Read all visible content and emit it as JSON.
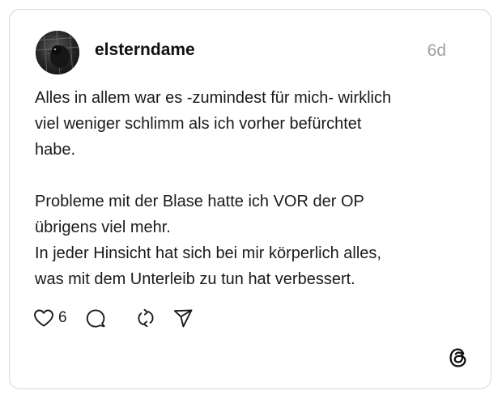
{
  "post": {
    "username": "elsterndame",
    "timestamp": "6d",
    "paragraphs": [
      "Alles in allem war es -zumindest für mich- wirklich\nviel weniger schlimm als ich vorher befürchtet\nhabe.",
      "Probleme mit der Blase hatte ich VOR der OP\nübrigens viel mehr.\nIn jeder Hinsicht hat sich bei mir körperlich alles,\nwas mit dem Unterleib zu tun hat verbessert."
    ]
  },
  "actions": {
    "like_count": "6",
    "icons": [
      "heart-icon",
      "comment-icon",
      "repost-icon",
      "share-icon"
    ]
  },
  "branding": {
    "logo_icon": "threads-logo-icon"
  },
  "colors": {
    "background": "#ffffff",
    "card_border": "#d6d6d6",
    "text": "#1a1a1a",
    "timestamp": "#a1a1a1"
  }
}
